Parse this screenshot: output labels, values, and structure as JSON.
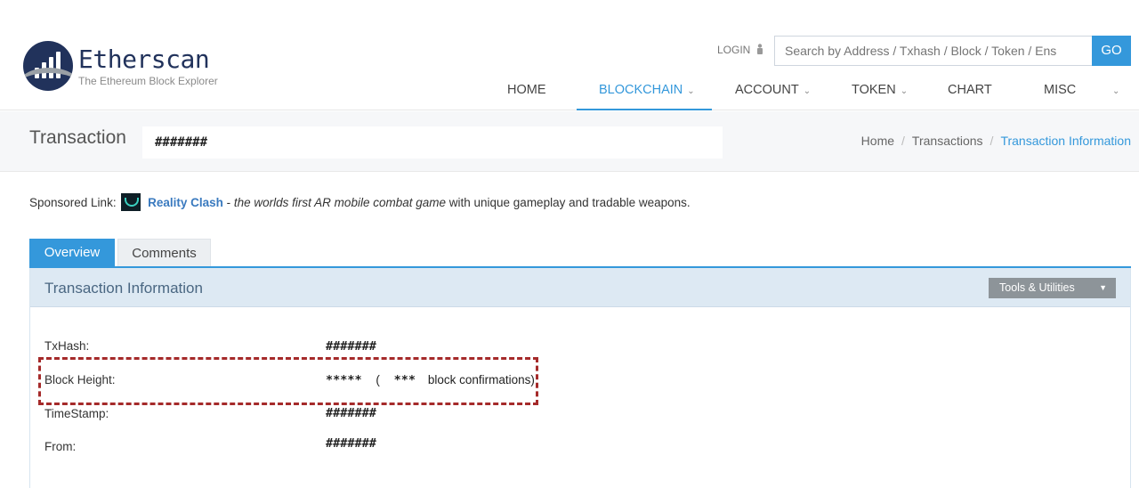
{
  "brand": {
    "title": "Etherscan",
    "subtitle": "The Ethereum Block Explorer"
  },
  "header": {
    "login_label": "LOGIN",
    "search_placeholder": "Search by Address / Txhash / Block / Token / Ens",
    "go_label": "GO"
  },
  "nav": {
    "items": [
      {
        "label": "HOME",
        "dropdown": false
      },
      {
        "label": "BLOCKCHAIN",
        "dropdown": true,
        "active": true
      },
      {
        "label": "ACCOUNT",
        "dropdown": true
      },
      {
        "label": "TOKEN",
        "dropdown": true
      },
      {
        "label": "CHART",
        "dropdown": false
      },
      {
        "label": "MISC",
        "dropdown": false
      }
    ],
    "more_chevron": "chevron-down-icon"
  },
  "page": {
    "title": "Transaction",
    "hash": "#######"
  },
  "breadcrumb": {
    "home": "Home",
    "transactions": "Transactions",
    "current": "Transaction Information"
  },
  "sponsored": {
    "label": "Sponsored Link:",
    "link": "Reality Clash",
    "dash": " - ",
    "italic": "the worlds first AR mobile combat game",
    "rest": " with unique gameplay and tradable weapons."
  },
  "tabs": {
    "overview": "Overview",
    "comments": "Comments"
  },
  "panel": {
    "title": "Transaction Information",
    "tools_label": "Tools & Utilities"
  },
  "details": {
    "txhash_label": "TxHash:",
    "txhash_value": "#######",
    "block_label": "Block Height:",
    "block_value": "*****",
    "confirm_open": "(",
    "confirm_count": "***",
    "confirm_text": "block confirmations)",
    "timestamp_label": "TimeStamp:",
    "timestamp_value": "#######",
    "from_label": "From:",
    "from_value": "#######"
  },
  "colors": {
    "accent": "#3498db",
    "brand": "#21325b",
    "highlight_border": "#a52a2a"
  }
}
